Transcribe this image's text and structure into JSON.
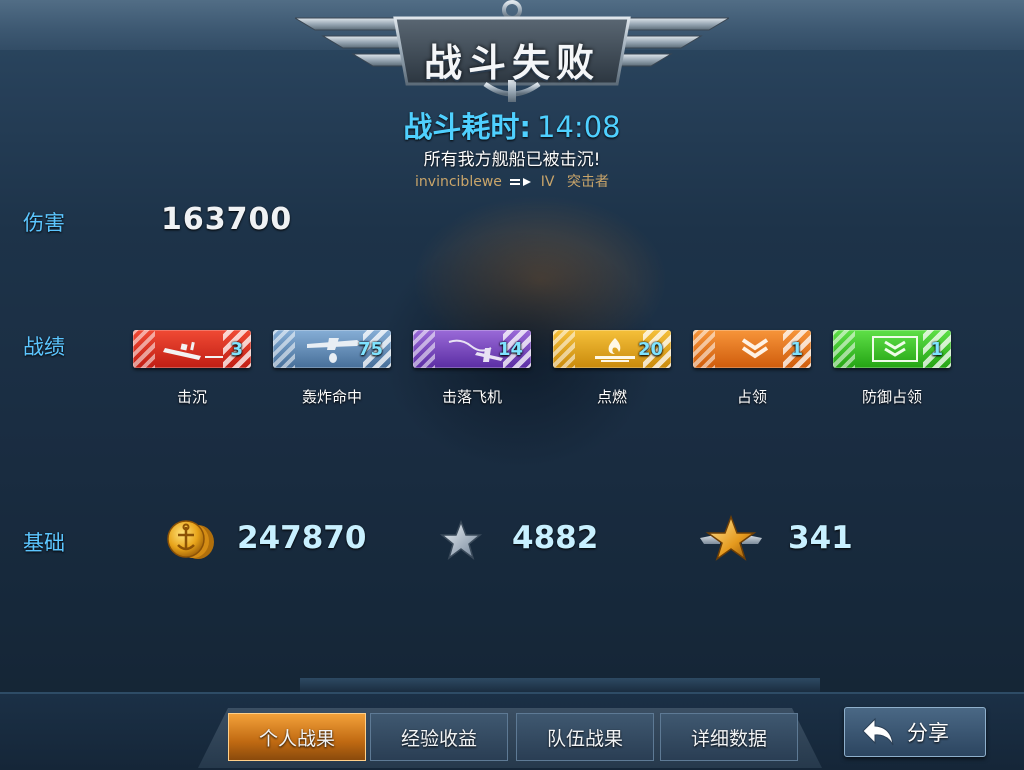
{
  "banner": {
    "title": "战斗失败"
  },
  "battle": {
    "duration_label": "战斗耗时:",
    "duration_value": "14:08",
    "result_message": "所有我方舰船已被击沉!",
    "player_name": "invinciblewe",
    "tier": "IV",
    "ship_name": "突击者"
  },
  "damage": {
    "label": "伤害",
    "value": "163700"
  },
  "achievements": {
    "label": "战绩",
    "items": [
      {
        "name": "击沉",
        "count": "3",
        "color": "#d8281c",
        "icon": "sinking-ship-icon"
      },
      {
        "name": "轰炸命中",
        "count": "75",
        "color": "#5b86b3",
        "icon": "bomber-icon"
      },
      {
        "name": "击落飞机",
        "count": "14",
        "color": "#7a45c0",
        "icon": "downed-plane-icon"
      },
      {
        "name": "点燃",
        "count": "20",
        "color": "#e0a417",
        "icon": "fire-icon"
      },
      {
        "name": "占领",
        "count": "1",
        "color": "#e87a16",
        "icon": "chevron-capture-icon"
      },
      {
        "name": "防御占领",
        "count": "1",
        "color": "#3cc42a",
        "icon": "defend-capture-icon"
      }
    ]
  },
  "base": {
    "label": "基础",
    "credits": "247870",
    "experience": "4882",
    "captain_experience": "341"
  },
  "tabs": [
    {
      "label": "个人战果",
      "active": true
    },
    {
      "label": "经验收益",
      "active": false
    },
    {
      "label": "队伍战果",
      "active": false
    },
    {
      "label": "详细数据",
      "active": false
    }
  ],
  "share": {
    "label": "分享"
  }
}
